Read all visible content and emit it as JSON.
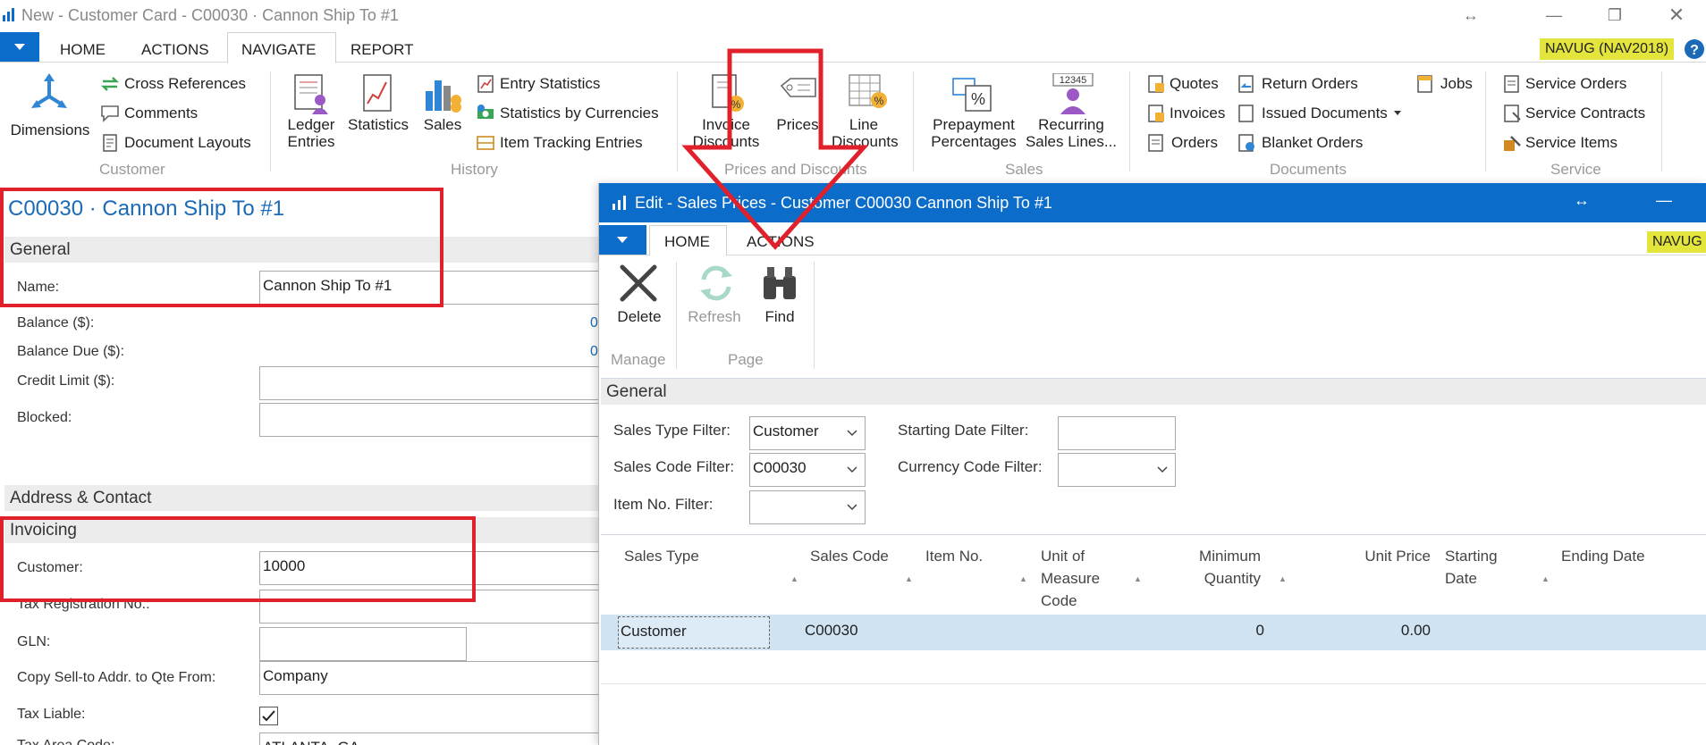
{
  "window": {
    "title": "New - Customer Card - C00030 · Cannon Ship To #1"
  },
  "menu": {
    "tabs": [
      "HOME",
      "ACTIONS",
      "NAVIGATE",
      "REPORT"
    ],
    "active_tab": "NAVIGATE",
    "company_badge": "NAVUG (NAV2018)"
  },
  "ribbon": {
    "customer": {
      "group": "Customer",
      "dimensions": "Dimensions",
      "cross_references": "Cross References",
      "comments": "Comments",
      "document_layouts": "Document Layouts"
    },
    "history": {
      "group": "History",
      "ledger_entries_1": "Ledger",
      "ledger_entries_2": "Entries",
      "statistics": "Statistics",
      "sales": "Sales",
      "entry_statistics": "Entry Statistics",
      "statistics_by_currencies": "Statistics by Currencies",
      "item_tracking_entries": "Item Tracking Entries"
    },
    "prices": {
      "group": "Prices and Discounts",
      "invoice_discounts_1": "Invoice",
      "invoice_discounts_2": "Discounts",
      "prices": "Prices",
      "line_discounts_1": "Line",
      "line_discounts_2": "Discounts"
    },
    "sales": {
      "group": "Sales",
      "prepayment_1": "Prepayment",
      "prepayment_2": "Percentages",
      "recurring_1": "Recurring",
      "recurring_2": "Sales Lines..."
    },
    "documents": {
      "group": "Documents",
      "quotes": "Quotes",
      "invoices": "Invoices",
      "orders": "Orders",
      "return_orders": "Return Orders",
      "issued_documents": "Issued Documents",
      "blanket_orders": "Blanket Orders",
      "jobs": "Jobs"
    },
    "service": {
      "group": "Service",
      "service_orders": "Service Orders",
      "service_contracts": "Service Contracts",
      "service_items": "Service Items"
    }
  },
  "card": {
    "title": "C00030 · Cannon Ship To #1",
    "general_label": "General",
    "name_label": "Name:",
    "name_value": "Cannon Ship To #1",
    "balance_label": "Balance ($):",
    "balance_value": "0",
    "balance_due_label": "Balance Due ($):",
    "balance_due_value": "0",
    "credit_limit_label": "Credit Limit ($):",
    "blocked_label": "Blocked:",
    "address_label": "Address & Contact",
    "invoicing_label": "Invoicing",
    "customer_label": "Customer:",
    "customer_value": "10000",
    "tax_reg_label": "Tax Registration No.:",
    "gln_label": "GLN:",
    "copy_sell_label": "Copy Sell-to Addr. to Qte From:",
    "copy_sell_value": "Company",
    "tax_liable_label": "Tax Liable:",
    "tax_liable_checked": true,
    "tax_area_label": "Tax Area Code:",
    "tax_area_value": "ATLANTA, GA"
  },
  "dialog": {
    "title": "Edit - Sales Prices - Customer C00030 Cannon Ship To #1",
    "tabs": [
      "HOME",
      "ACTIONS"
    ],
    "active_tab": "HOME",
    "badge": "NAVUG",
    "delete": "Delete",
    "refresh": "Refresh",
    "find": "Find",
    "manage_group": "Manage",
    "page_group": "Page",
    "general_label": "General",
    "filters": {
      "sales_type_label": "Sales Type Filter:",
      "sales_type_value": "Customer",
      "sales_code_label": "Sales Code Filter:",
      "sales_code_value": "C00030",
      "item_no_label": "Item No. Filter:",
      "item_no_value": "",
      "starting_date_label": "Starting Date Filter:",
      "starting_date_value": "",
      "currency_label": "Currency Code Filter:",
      "currency_value": ""
    },
    "columns": {
      "sales_type": "Sales Type",
      "sales_code": "Sales Code",
      "item_no": "Item No.",
      "uom_1": "Unit of",
      "uom_2": "Measure",
      "uom_3": "Code",
      "min_qty_1": "Minimum",
      "min_qty_2": "Quantity",
      "unit_price": "Unit Price",
      "starting_date_1": "Starting",
      "starting_date_2": "Date",
      "ending_date": "Ending Date"
    },
    "row": {
      "sales_type": "Customer",
      "sales_code": "C00030",
      "min_qty": "0",
      "unit_price": "0.00"
    }
  },
  "colors": {
    "accent": "#0b6cc9",
    "highlight": "#e0202a",
    "badge": "#e3e43c",
    "row_selected": "#cfe3f3"
  }
}
